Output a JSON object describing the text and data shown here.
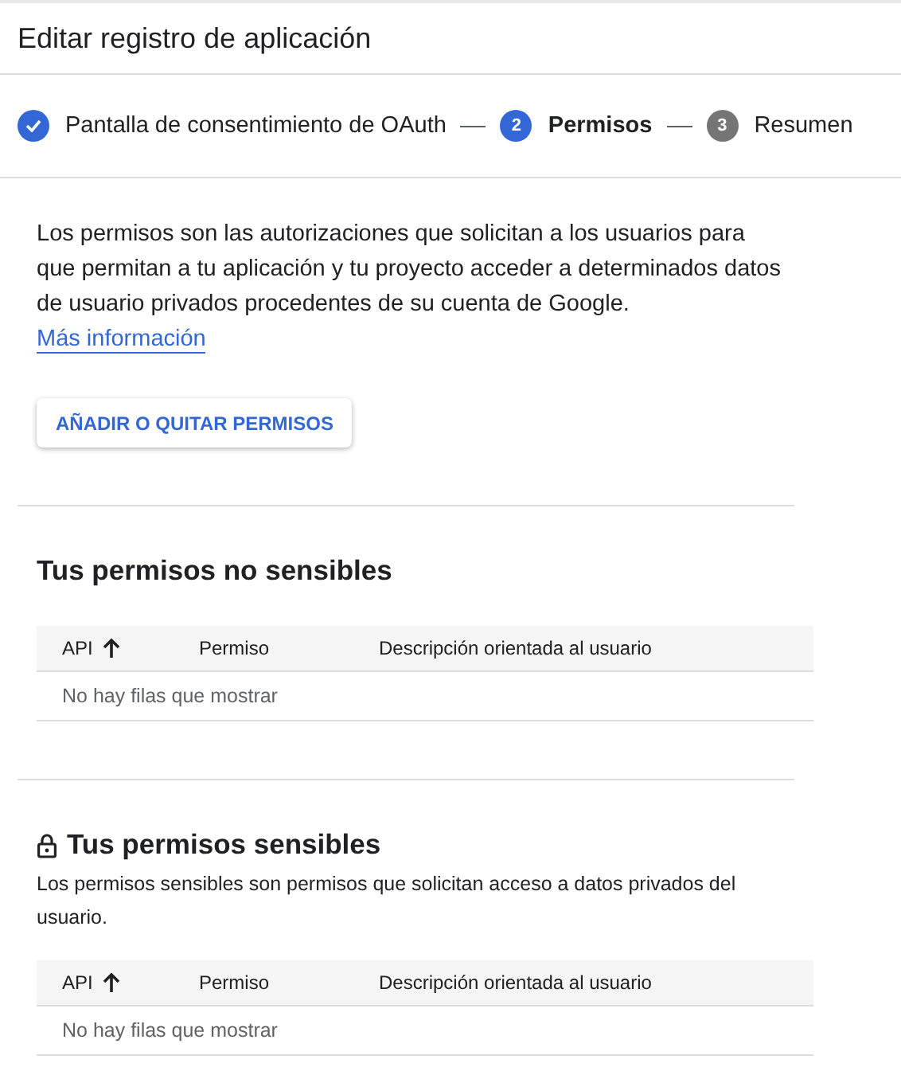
{
  "header": {
    "title": "Editar registro de aplicación"
  },
  "steps": [
    {
      "label": "Pantalla de consentimiento de OAuth",
      "completed": true,
      "selected": false
    },
    {
      "number": "2",
      "label": "Permisos",
      "completed": false,
      "selected": true
    },
    {
      "number": "3",
      "label": "Resumen",
      "completed": false,
      "selected": false
    }
  ],
  "intro": {
    "text": "Los permisos son las autorizaciones que solicitan a los usuarios para que permitan a tu aplicación y tu proyecto acceder a determinados datos de usuario privados procedentes de su cuenta de Google.",
    "link": "Más información"
  },
  "action_button": "AÑADIR O QUITAR PERMISOS",
  "sections": [
    {
      "title": "Tus permisos no sensibles",
      "locked": false,
      "columns": [
        {
          "label": "API",
          "sorted": true
        },
        {
          "label": "Permiso",
          "sorted": false
        },
        {
          "label": "Descripción orientada al usuario",
          "sorted": false
        }
      ],
      "empty_message": "No hay filas que mostrar"
    },
    {
      "title": "Tus permisos sensibles",
      "locked": true,
      "description": "Los permisos sensibles son permisos que solicitan acceso a datos privados del usuario.",
      "columns": [
        {
          "label": "API",
          "sorted": true
        },
        {
          "label": "Permiso",
          "sorted": false
        },
        {
          "label": "Descripción orientada al usuario",
          "sorted": false
        }
      ],
      "empty_message": "No hay filas que mostrar"
    }
  ]
}
